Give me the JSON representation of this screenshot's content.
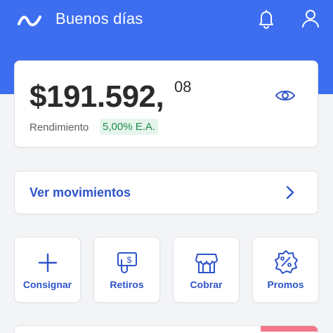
{
  "header": {
    "greeting": "Buenos días",
    "icons": {
      "logo": "brand-logo-icon",
      "notifications": "bell-icon",
      "profile": "user-icon"
    }
  },
  "balance": {
    "amount": "$191.592,",
    "cents": "08",
    "yield_label": "Rendimiento",
    "yield_value": "5,00% E.A.",
    "visibility_icon": "eye-icon"
  },
  "movements": {
    "label": "Ver movimientos",
    "icon": "chevron-right-icon"
  },
  "actions": [
    {
      "label": "Consignar",
      "icon": "plus-icon"
    },
    {
      "label": "Retiros",
      "icon": "cash-withdraw-icon"
    },
    {
      "label": "Cobrar",
      "icon": "store-icon"
    },
    {
      "label": "Promos",
      "icon": "discount-badge-icon"
    }
  ],
  "colors": {
    "brand": "#3d6ef0",
    "accent_text": "#2e54c8",
    "yield_green": "#1f8a4c",
    "promo_pink": "#f2778a"
  }
}
